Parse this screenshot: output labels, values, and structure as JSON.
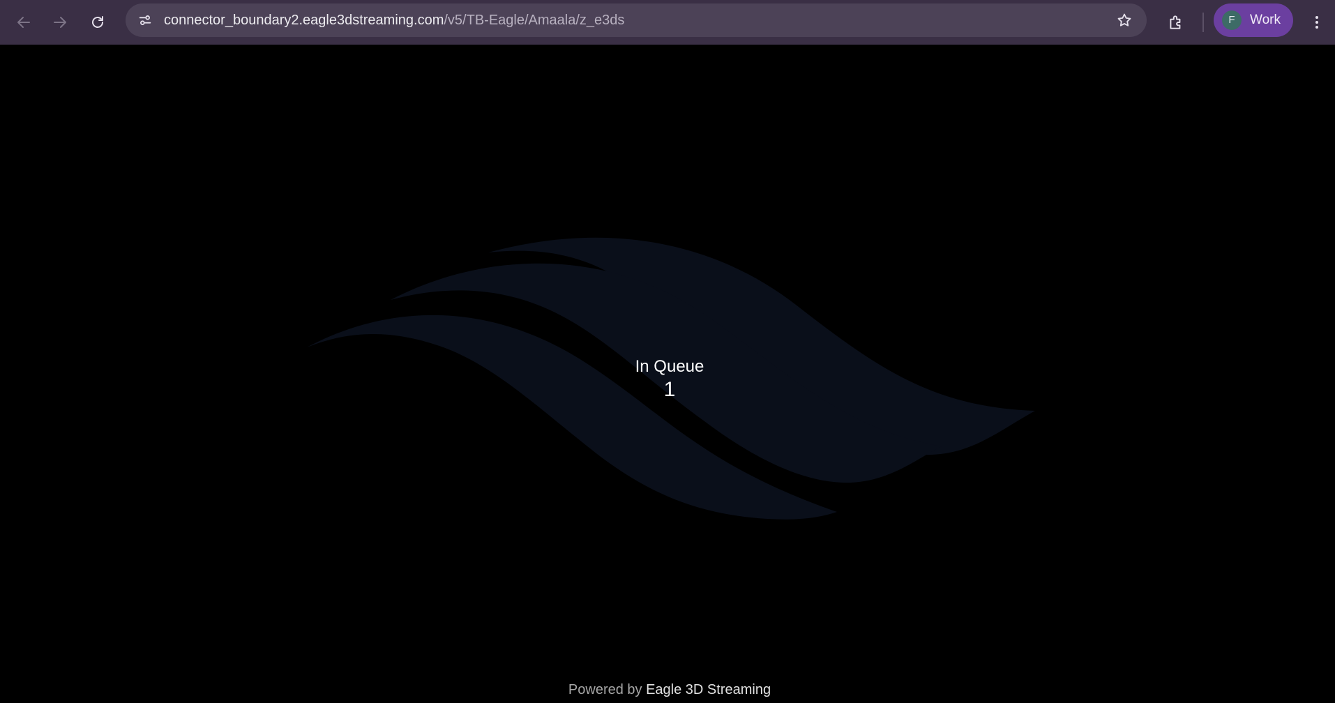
{
  "browser": {
    "url_host": "connector_boundary2.eagle3dstreaming.com",
    "url_path": "/v5/TB-Eagle/Amaala/z_e3ds",
    "profile_initial": "F",
    "profile_label": "Work",
    "icons": {
      "back": "back-arrow-icon",
      "forward": "forward-arrow-icon",
      "reload": "reload-icon",
      "site_info": "site-settings-icon",
      "bookmark": "star-icon",
      "extensions": "puzzle-icon",
      "menu": "kebab-menu-icon"
    }
  },
  "page": {
    "queue_label": "In Queue",
    "queue_position": "1",
    "powered_prefix": "Powered by ",
    "powered_brand": "Eagle 3D Streaming",
    "logo": "eagle-wave-logo"
  },
  "colors": {
    "toolbar": "#3a2f45",
    "omnibox": "#4c4257",
    "profile_chip": "#6b3fa0",
    "background": "#000000",
    "logo": "#0a0f1a"
  }
}
